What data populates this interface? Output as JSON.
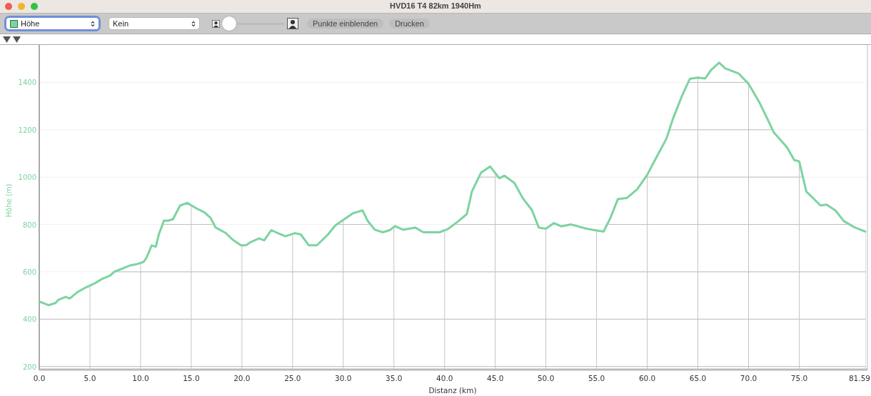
{
  "window": {
    "title": "HVD16 T4 82km 1940Hm"
  },
  "toolbar": {
    "primary_select": {
      "value": "Höhe",
      "focused": true
    },
    "secondary_select": {
      "value": "Kein",
      "focused": false
    },
    "zoom_slider": {
      "level": 0
    },
    "buttons": [
      "Punkte einblenden",
      "Drucken"
    ]
  },
  "chart": {
    "chart_data": {
      "type": "line",
      "xlabel": "Distanz (km)",
      "ylabel": "Höhe (m)",
      "grid": true,
      "x": [
        0,
        0.9,
        1.6,
        1.9,
        2.6,
        3.0,
        3.8,
        4.6,
        5.5,
        6.2,
        7.0,
        7.4,
        8.1,
        8.9,
        9.6,
        10.3,
        10.6,
        11.1,
        11.5,
        11.8,
        12.3,
        12.7,
        13.2,
        13.9,
        14.6,
        15.5,
        16.3,
        16.9,
        17.4,
        18.4,
        19.1,
        19.9,
        20.4,
        20.9,
        21.7,
        22.2,
        22.9,
        23.6,
        24.3,
        25.2,
        25.8,
        26.6,
        27.4,
        28.5,
        29.2,
        30.1,
        31.0,
        31.9,
        32.4,
        33.1,
        33.9,
        34.6,
        35.1,
        35.9,
        37.1,
        37.9,
        39.5,
        40.3,
        41.3,
        42.2,
        42.7,
        43.6,
        44.5,
        45.4,
        45.9,
        46.9,
        47.7,
        48.6,
        49.3,
        50.0,
        50.8,
        51.5,
        52.5,
        54.0,
        55.0,
        55.7,
        56.4,
        57.1,
        58.0,
        59.0,
        60.0,
        61.1,
        61.9,
        62.5,
        63.4,
        64.2,
        65.0,
        65.7,
        66.3,
        67.1,
        67.7,
        69.0,
        70.0,
        71.1,
        71.9,
        72.5,
        73.8,
        74.5,
        75.0,
        75.7,
        77.1,
        77.7,
        78.6,
        79.4,
        80.5,
        81.59
      ],
      "series": [
        {
          "color": "#7dd3a0",
          "values": [
            474,
            459,
            468,
            482,
            494,
            487,
            515,
            534,
            552,
            570,
            584,
            600,
            612,
            626,
            632,
            642,
            660,
            712,
            706,
            758,
            816,
            816,
            822,
            880,
            891,
            868,
            851,
            828,
            787,
            764,
            735,
            712,
            712,
            726,
            741,
            733,
            776,
            762,
            750,
            763,
            758,
            712,
            712,
            758,
            795,
            822,
            848,
            859,
            816,
            778,
            767,
            776,
            793,
            778,
            787,
            767,
            767,
            780,
            812,
            844,
            939,
            1019,
            1045,
            995,
            1006,
            975,
            912,
            862,
            787,
            782,
            806,
            792,
            800,
            782,
            775,
            770,
            831,
            907,
            912,
            948,
            1010,
            1099,
            1162,
            1242,
            1340,
            1415,
            1420,
            1416,
            1452,
            1483,
            1459,
            1438,
            1394,
            1313,
            1242,
            1188,
            1126,
            1072,
            1066,
            939,
            880,
            884,
            858,
            814,
            787,
            769
          ]
        }
      ],
      "xlim": [
        0,
        81.59
      ],
      "ylim": [
        190,
        1555
      ],
      "xticks": [
        {
          "value": 0,
          "label": "0.0"
        },
        {
          "value": 5,
          "label": "5.0"
        },
        {
          "value": 10,
          "label": "10.0"
        },
        {
          "value": 15,
          "label": "15.0"
        },
        {
          "value": 20,
          "label": "20.0"
        },
        {
          "value": 25,
          "label": "25.0"
        },
        {
          "value": 30,
          "label": "30.0"
        },
        {
          "value": 35,
          "label": "35.0"
        },
        {
          "value": 40,
          "label": "40.0"
        },
        {
          "value": 45,
          "label": "45.0"
        },
        {
          "value": 50,
          "label": "50.0"
        },
        {
          "value": 55,
          "label": "55.0"
        },
        {
          "value": 60,
          "label": "60.0"
        },
        {
          "value": 65,
          "label": "65.0"
        },
        {
          "value": 70,
          "label": "70.0"
        },
        {
          "value": 75,
          "label": "75.0"
        },
        {
          "value": 81.59,
          "label": "81.59"
        }
      ],
      "yticks": [
        200,
        400,
        600,
        800,
        1000,
        1200,
        1400
      ]
    }
  }
}
